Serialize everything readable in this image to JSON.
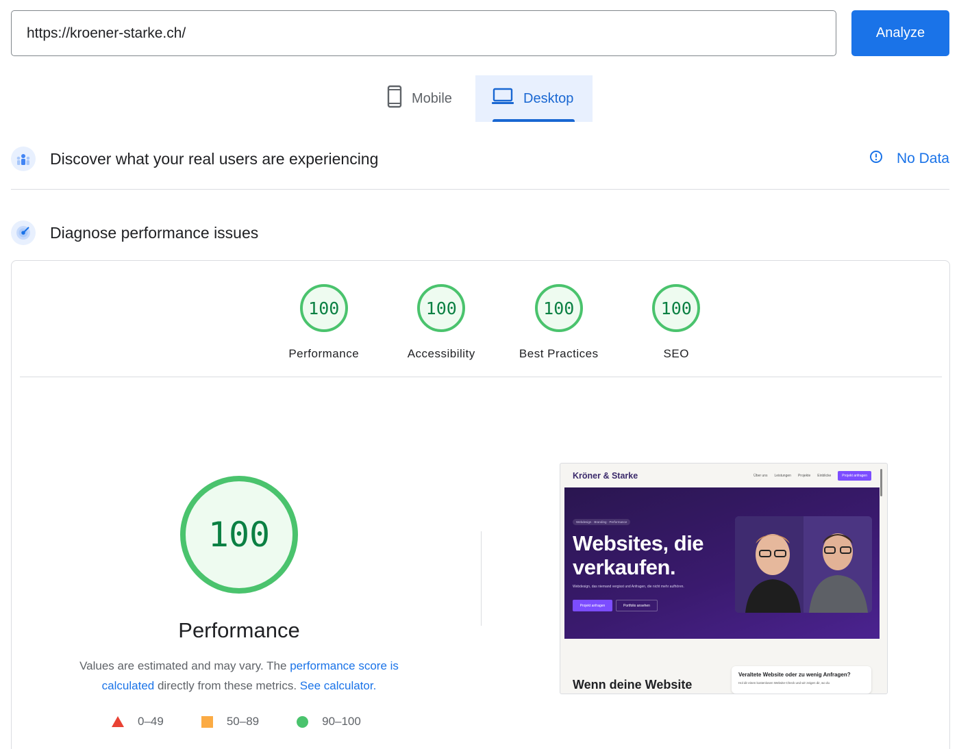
{
  "search": {
    "url": "https://kroener-starke.ch/",
    "analyze_label": "Analyze"
  },
  "device_tabs": {
    "mobile_label": "Mobile",
    "desktop_label": "Desktop",
    "selected": "Desktop"
  },
  "crux": {
    "title": "Discover what your real users are experiencing",
    "status": "No Data"
  },
  "diagnose": {
    "title": "Diagnose performance issues"
  },
  "categories": [
    {
      "score": "100",
      "label": "Performance"
    },
    {
      "score": "100",
      "label": "Accessibility"
    },
    {
      "score": "100",
      "label": "Best Practices"
    },
    {
      "score": "100",
      "label": "SEO"
    }
  ],
  "performance": {
    "score": "100",
    "title": "Performance",
    "desc_prefix": "Values are estimated and may vary. The ",
    "desc_link": "performance score is calculated",
    "desc_mid": " directly from these metrics. ",
    "desc_calc_link": "See calculator."
  },
  "legend": [
    {
      "range": "0–49",
      "color": "#e94234"
    },
    {
      "range": "50–89",
      "color": "#fbab44"
    },
    {
      "range": "90–100",
      "color": "#4ac36d"
    }
  ],
  "screenshot": {
    "brand": "Kröner & Starke",
    "nav_links": [
      "Über uns",
      "Leistungen",
      "Projekte",
      "Einblicke"
    ],
    "nav_cta": "Projekt anfragen",
    "pill": "Webdesign · Branding · Performance",
    "headline": "Websites, die verkaufen.",
    "subline": "Webdesign, das niemand vergisst und Anfragen, die nicht mehr aufhören.",
    "btn_primary": "Projekt anfragen",
    "btn_secondary": "Portfolio ansehen",
    "section_heading": "Wenn deine Website",
    "card_title": "Veraltete Website oder zu wenig Anfragen?",
    "card_sub": "Hol dir einen kostenlosen Website-Check und wir zeigen dir, wo du"
  },
  "colors": {
    "accent": "#1a73e8",
    "pass_green": "#4ac36d",
    "score_text": "#0b8043"
  }
}
